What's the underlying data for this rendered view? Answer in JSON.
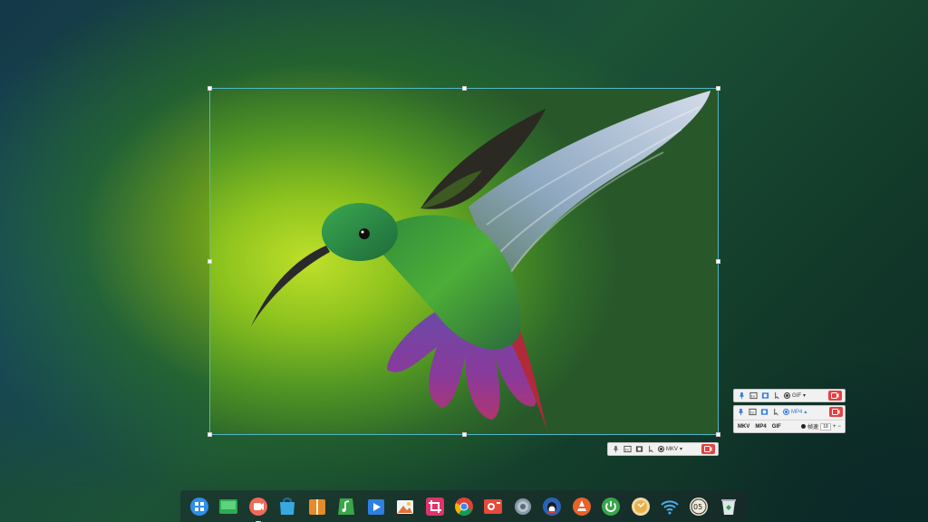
{
  "toolbar_main": {
    "format": "MKV",
    "icons": [
      "microphone-icon",
      "keystroke-icon",
      "webcam-icon",
      "cursor-icon",
      "record-format-icon",
      "record-start-icon"
    ]
  },
  "toolbar_gif": {
    "format": "GIF",
    "icons": [
      "microphone-icon",
      "keystroke-icon",
      "webcam-icon",
      "cursor-icon",
      "record-format-icon",
      "record-start-icon"
    ]
  },
  "toolbar_mp4": {
    "format": "MP4",
    "options": [
      "MKV",
      "MP4",
      "GIF"
    ],
    "quality_label": "帧速",
    "fps_value": "18"
  },
  "dock": {
    "items": [
      "launcher-icon",
      "desktop-icon",
      "screen-recorder-icon",
      "app-store-icon",
      "file-archiver-icon",
      "music-icon",
      "video-player-icon",
      "image-viewer-icon",
      "screenshot-icon",
      "chrome-icon",
      "camera-app-icon",
      "settings-icon",
      "qq-icon",
      "vlc-icon",
      "power-icon",
      "calendar-icon",
      "wifi-icon",
      "clock-icon",
      "trash-icon"
    ]
  },
  "colors": {
    "selection_border": "#4fb7c7",
    "record_red": "#e84040",
    "active_blue": "#2c7be0"
  }
}
